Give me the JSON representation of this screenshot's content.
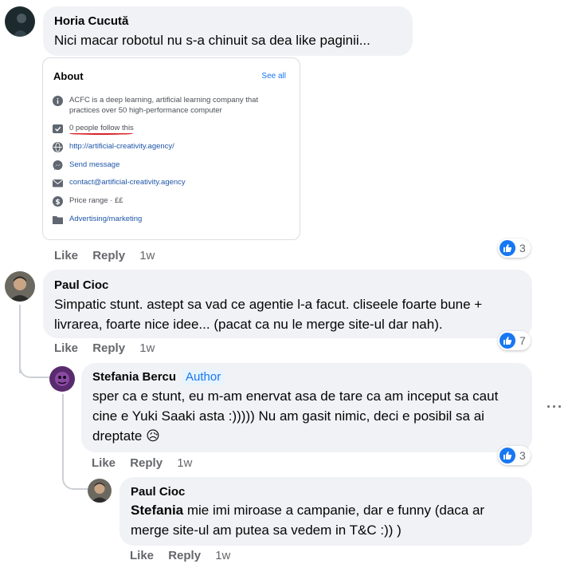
{
  "comments": [
    {
      "author": "Horia Cucută",
      "text": "Nici macar robotul nu s-a chinuit sa dea like paginii...",
      "like": "Like",
      "reply": "Reply",
      "time": "1w",
      "reactions": "3"
    },
    {
      "author": "Paul Cioc",
      "text": "Simpatic stunt. astept sa vad ce agentie l-a facut. cliseele foarte bune + livrarea, foarte nice idee... (pacat ca nu le merge site-ul dar nah).",
      "like": "Like",
      "reply": "Reply",
      "time": "1w",
      "reactions": "7"
    },
    {
      "author": "Stefania Bercu",
      "badge": "Author",
      "text": "sper ca e stunt, eu m-am enervat asa de tare ca am inceput sa caut cine e Yuki Saaki asta :))))) Nu am gasit nimic, deci e posibil sa ai dreptate 😥",
      "like": "Like",
      "reply": "Reply",
      "time": "1w",
      "reactions": "3"
    },
    {
      "author": "Paul Cioc",
      "mention": "Stefania",
      "text": " mie imi miroase a campanie, dar e funny (daca ar merge site-ul am putea sa vedem in T&C :)) )",
      "like": "Like",
      "reply": "Reply",
      "time": "1w"
    }
  ],
  "about_card": {
    "title": "About",
    "see_all": "See all",
    "rows": [
      {
        "icon": "info-icon",
        "text": "ACFC is a deep learning, artificial learning company that practices over 50 high-performance computer"
      },
      {
        "icon": "follow-check-icon",
        "text": "0 people follow this"
      },
      {
        "icon": "globe-icon",
        "text": "http://artificial-creativity.agency/"
      },
      {
        "icon": "messenger-icon",
        "text": "Send message"
      },
      {
        "icon": "email-icon",
        "text": "contact@artificial-creativity.agency"
      },
      {
        "icon": "price-icon",
        "text": "Price range · ££"
      },
      {
        "icon": "category-icon",
        "text": "Advertising/marketing"
      }
    ]
  },
  "more_options": "···",
  "colors": {
    "bubble": "#f0f2f5",
    "like_blue": "#1877f2",
    "meta_gray": "#65676b",
    "annotation_red": "#d8232a"
  }
}
